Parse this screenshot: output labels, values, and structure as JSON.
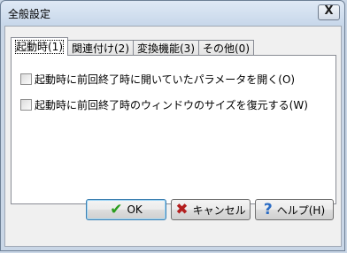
{
  "window": {
    "title": "全般設定",
    "close_glyph": "X"
  },
  "tabs": [
    {
      "label": "起動時(1)",
      "active": true
    },
    {
      "label": "関連付け(2)",
      "active": false
    },
    {
      "label": "変換機能(3)",
      "active": false
    },
    {
      "label": "その他(0)",
      "active": false
    }
  ],
  "options": [
    {
      "label": "起動時に前回終了時に開いていたパラメータを開く(O)",
      "checked": false
    },
    {
      "label": "起動時に前回終了時のウィンドウのサイズを復元する(W)",
      "checked": false
    }
  ],
  "buttons": {
    "ok": {
      "label": "OK",
      "icon": "check-icon",
      "glyph": "✔"
    },
    "cancel": {
      "label": "キャンセル",
      "icon": "x-icon",
      "glyph": "✖"
    },
    "help": {
      "label": "ヘルプ(H)",
      "icon": "question-icon",
      "glyph": "?"
    }
  },
  "colors": {
    "title_bar": "#c7d7ea",
    "ok_icon": "#2a9d1e",
    "cancel_icon": "#b41f1f",
    "help_icon": "#2b6cc4"
  }
}
